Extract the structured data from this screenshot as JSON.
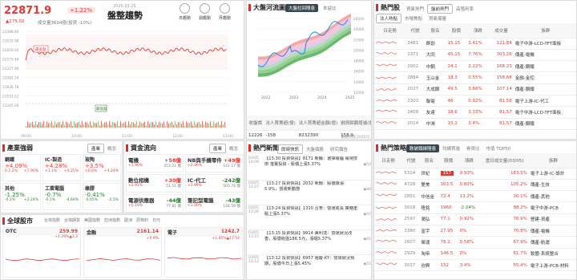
{
  "index": {
    "value": "22871.9",
    "change_pct": "+1.22%",
    "change": "▲275.02",
    "volume": "成交量3604億(投資 -10%)",
    "name": "盤整趨勢",
    "date": "2025.03.25",
    "buttons": [
      "日趨勢",
      "週趨勢",
      "月趨勢"
    ],
    "yticks": [
      "23388.80",
      "23033.98",
      "22819.02",
      "22573.46",
      "22327.90",
      "22082.34",
      "21836.78",
      "21591.22",
      "21345.66"
    ],
    "xticks": [
      "09:00",
      "10:00",
      "11:00",
      "12:00",
      "13:00"
    ],
    "note_low": "最低點",
    "note_high": "最高點"
  },
  "sector": {
    "title": "產業強弱",
    "tabs": [
      "產業",
      "概念"
    ],
    "items": [
      {
        "name": "鋼鐵",
        "pct": "+4.09%",
        "sub1": "0.2.2%",
        "sub2": "+7.90%",
        "color": "#e53935"
      },
      {
        "name": "IC-製造",
        "pct": "+4.28%",
        "sub1": "+1.1%",
        "sub2": "+0.25%",
        "color": "#e53935"
      },
      {
        "name": "玻陶",
        "pct": "+3.5%",
        "sub1": "+0.6%",
        "sub2": "+4.24%",
        "color": "#e53935"
      },
      {
        "name": "其他",
        "pct": "-1.25%",
        "sub1": "-0.2%",
        "sub2": "+2.24%",
        "color": "#2e7d32"
      },
      {
        "name": "工業電腦",
        "pct": "-0.7%",
        "sub1": "-0.1%",
        "sub2": "-4.66%",
        "color": "#2e7d32"
      },
      {
        "name": "橡膠",
        "pct": "-0.41%",
        "sub1": "-0.05%",
        "sub2": "-2.5%",
        "color": "#2e7d32"
      }
    ]
  },
  "fund": {
    "title": "資金流向",
    "tabs": [
      "產業",
      "概念"
    ],
    "items": [
      {
        "name": "電機",
        "val": "+58億",
        "pct": "+1.90%",
        "vol": "253.21 億",
        "color": "#e53935"
      },
      {
        "name": "NB與手機零件",
        "val": "+49億",
        "pct": "+2.96%",
        "vol": "141.17 億",
        "color": "#e53935"
      },
      {
        "name": "數位相機",
        "val": "+30億",
        "pct": "+2.91%",
        "vol": "51.51 億",
        "color": "#e53935"
      },
      {
        "name": "IC-代工",
        "val": "-242億",
        "pct": "+1.99%",
        "vol": "505.76 億",
        "color": "#2e7d32"
      },
      {
        "name": "電源供應器",
        "val": "-44億",
        "pct": "+0.19%",
        "vol": "77.81 億",
        "color": "#2e7d32"
      },
      {
        "name": "筆記型電腦",
        "val": "-43億",
        "pct": "+1.00%",
        "vol": "124.59 億",
        "color": "#2e7d32"
      }
    ]
  },
  "global": {
    "title": "全球股市",
    "tabs": [
      "台灣指數",
      "台灣期貨",
      "美國指數",
      "亞洲指數",
      "歐洲",
      "原物料",
      "日元"
    ],
    "cards": [
      {
        "name": "OTC",
        "value": "259.99",
        "chg": "+1.29%",
        "chg2": "▲3.3"
      },
      {
        "name": "金融",
        "value": "2161.14",
        "chg": "+0.6%",
        "chg2": ""
      },
      {
        "name": "電子",
        "value": "1242.7",
        "chg": "+1.41%",
        "chg2": "▲17.54"
      }
    ]
  },
  "wave": {
    "title": "大盤河流圖",
    "tabs": [
      "大盤拉回隱患",
      "本益比"
    ],
    "xticks": [
      "2022",
      "2023",
      "2024",
      "2025"
    ],
    "yticks": [
      "26000",
      "24000",
      "22000",
      "20000",
      "18000",
      "16000",
      "14000",
      "12000"
    ],
    "headers": [
      "收盤價",
      "法人買賣超(億)",
      "法人買賣超金額(億)",
      "融資餘額增減(億)"
    ],
    "values": [
      "12226",
      "-158",
      "8232390",
      "158.9"
    ],
    "note": "數據時間 2025/3"
  },
  "news": {
    "title": "熱門新聞",
    "tabs": [
      "即時快訊",
      "大盤個股",
      "研究報告"
    ],
    "items": [
      {
        "date": "03/05",
        "time": "14:09",
        "text": "【13:30 投資快訊】8171 新縣：選擇電腦 電視技術 落實投資 - 股價上漲5.37%",
        "count": "50"
      },
      {
        "date": "03/05",
        "time": "13:27",
        "text": "【13:27 投資快訊】2032 新鋼：股價爆漲5.9%，營運新動態",
        "count": "88"
      },
      {
        "date": "03/05",
        "time": "13:26",
        "text": "【13:24 投資快訊】1310 台苯：營運成長 策略重點上漲5.37%",
        "count": "47"
      },
      {
        "date": "03/05",
        "time": "13:15",
        "text": "【13:15 投資快訊】9914 美利達：營運狀況改善，股價收盤186.5元，漲幅5.37%",
        "count": "61"
      },
      {
        "date": "03/05",
        "time": "13:12",
        "text": "【13:12 投資快訊】6957 裕慶-KY：營運狀況預期，股價今日上漲5.45%",
        "count": "55"
      }
    ]
  },
  "hotstock": {
    "title": "熱門股",
    "tabs": [
      "買氣熱門",
      "盤前熱門",
      "高殖利率"
    ],
    "subtabs": [
      "法人熱點",
      "市場焦點",
      "買氣爆量"
    ],
    "headers": [
      "日走勢",
      "代號",
      "股名",
      "股價",
      "漲跌",
      "成交量",
      "族群"
    ],
    "rows": [
      {
        "code": "3481",
        "name": "群創",
        "price": "15.15",
        "pct": "3.41%",
        "vol": "121.84",
        "group": "電子中游-LCD-TFT面板"
      },
      {
        "code": "2371",
        "name": "大同",
        "price": "45.15",
        "pct": "7.76%",
        "vol": "303.26",
        "group": "傳產-電機"
      },
      {
        "code": "2002",
        "name": "中鋼",
        "price": "24.1",
        "pct": "2.22%",
        "vol": "168.23",
        "group": "傳產-鋼鐵"
      },
      {
        "code": "2884",
        "name": "玉山金",
        "price": "18.3",
        "pct": "0.55%",
        "vol": "158.68",
        "group": "金融-金控"
      },
      {
        "code": "2027",
        "name": "大成鋼",
        "price": "49.5",
        "pct": "3.66%",
        "vol": "107.14",
        "group": "傳產-鋼鐵"
      },
      {
        "code": "2303",
        "name": "聯電",
        "price": "46",
        "pct": "0.92%",
        "vol": "81.58",
        "group": "電子上游-IC-代工"
      },
      {
        "code": "2409",
        "name": "友達",
        "price": "18.6",
        "pct": "3.33%",
        "vol": "81.57",
        "group": "電子中游-LCD-TFT面板"
      },
      {
        "code": "2014",
        "name": "中鴻",
        "price": "15.2",
        "pct": "3.4%",
        "vol": "81.57",
        "group": "傳產-鋼鐵"
      }
    ]
  },
  "strategy": {
    "title": "熱門策略",
    "tabs": [
      "跌破頸線隱患",
      "均線買進",
      "券資比",
      "市值 TOP50"
    ],
    "headers": [
      "日走勢",
      "代號",
      "股名",
      "股價",
      "漲跌",
      "當日成交量(03/05)",
      "族群"
    ],
    "rows": [
      {
        "code": "5314",
        "name": "世紀",
        "price": "157",
        "pct": "9.93%",
        "vol": "183.5%",
        "group": "電子上游-IC-設計",
        "hl": true
      },
      {
        "code": "4728",
        "name": "雙美",
        "price": "303.5",
        "pct": "0.83%",
        "vol": "105.2%",
        "group": "傳產-生技",
        "hl": false
      },
      {
        "code": "2891",
        "name": "中信金",
        "price": "72.4",
        "pct": "13.2%",
        "vol": "30.1%",
        "group": "傳產-其他",
        "hl": false
      },
      {
        "code": "3018",
        "name": "隆銘",
        "price": "1960",
        "pct": "-2.24%",
        "vol": "88.2%",
        "group": "電子中游-PCB",
        "hl": false
      },
      {
        "code": "2597",
        "name": "潤弘",
        "price": "77.1",
        "pct": "0.92%",
        "vol": "76.9%",
        "group": "營建-資產",
        "hl": false
      },
      {
        "code": "3380",
        "name": "富宇",
        "price": "27.95",
        "pct": "0%",
        "vol": "70.8%",
        "group": "傳產-電機",
        "hl": false
      },
      {
        "code": "2607",
        "name": "榮運",
        "price": "78.2",
        "pct": "0.58%",
        "vol": "67.9%",
        "group": "傳產-航運",
        "hl": false
      },
      {
        "code": "2929",
        "name": "淘帝",
        "price": "146.5",
        "pct": "0%",
        "vol": "61.7%",
        "group": "軟體-系統整合",
        "hl": false
      },
      {
        "code": "3037",
        "name": "欣興",
        "price": "152",
        "pct": "3.4%",
        "vol": "55.4%",
        "group": "電子上游-PCB-材料",
        "hl": false
      }
    ]
  },
  "colors": {
    "up": "#e53935",
    "down": "#2e7d32",
    "dark": "#37474f"
  }
}
